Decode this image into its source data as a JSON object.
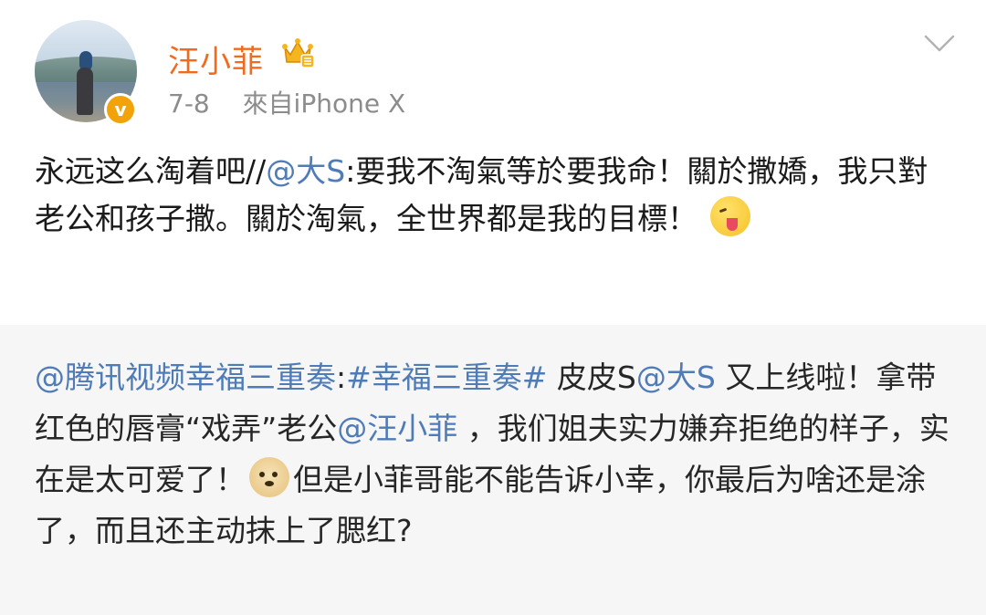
{
  "header": {
    "username": "汪小菲",
    "date": "7-8",
    "source": "來自iPhone X",
    "verified_badge": "v",
    "icons": {
      "avatar": "user-avatar-photo",
      "verified": "verified-badge-icon",
      "vip_crown": "vip-crown-icon",
      "menu": "chevron-down-icon"
    }
  },
  "post": {
    "prefix": "永远这么淘着吧//",
    "mention": "@大S",
    "body": ":要我不淘氣等於要我命！關於撒嬌，我只對老公和孩子撒。關於淘氣，全世界都是我的目標！",
    "emoji": "tongue-wink-emoji"
  },
  "repost": {
    "author_mention": "@腾讯视频幸福三重奏",
    "colon": ":",
    "topic": "#幸福三重奏#",
    "space1": " 皮皮S",
    "mention_ds": "@大S",
    "text1": " 又上线啦！拿带红色的唇膏“戏弄”老公",
    "mention_wxf": "@汪小菲",
    "text2": " ，我们姐夫实力嫌弃拒绝的样子，实在是太可爱了！",
    "emoji": "doge-emoji",
    "text3": "但是小菲哥能不能告诉小幸，你最后为啥还是涂了，而且还主动抹上了腮红?"
  },
  "colors": {
    "username": "#f26b1d",
    "link": "#4f7cb7",
    "meta": "#8c8c8c",
    "repost_bg": "#f6f6f6",
    "badge": "#f2a30a"
  }
}
